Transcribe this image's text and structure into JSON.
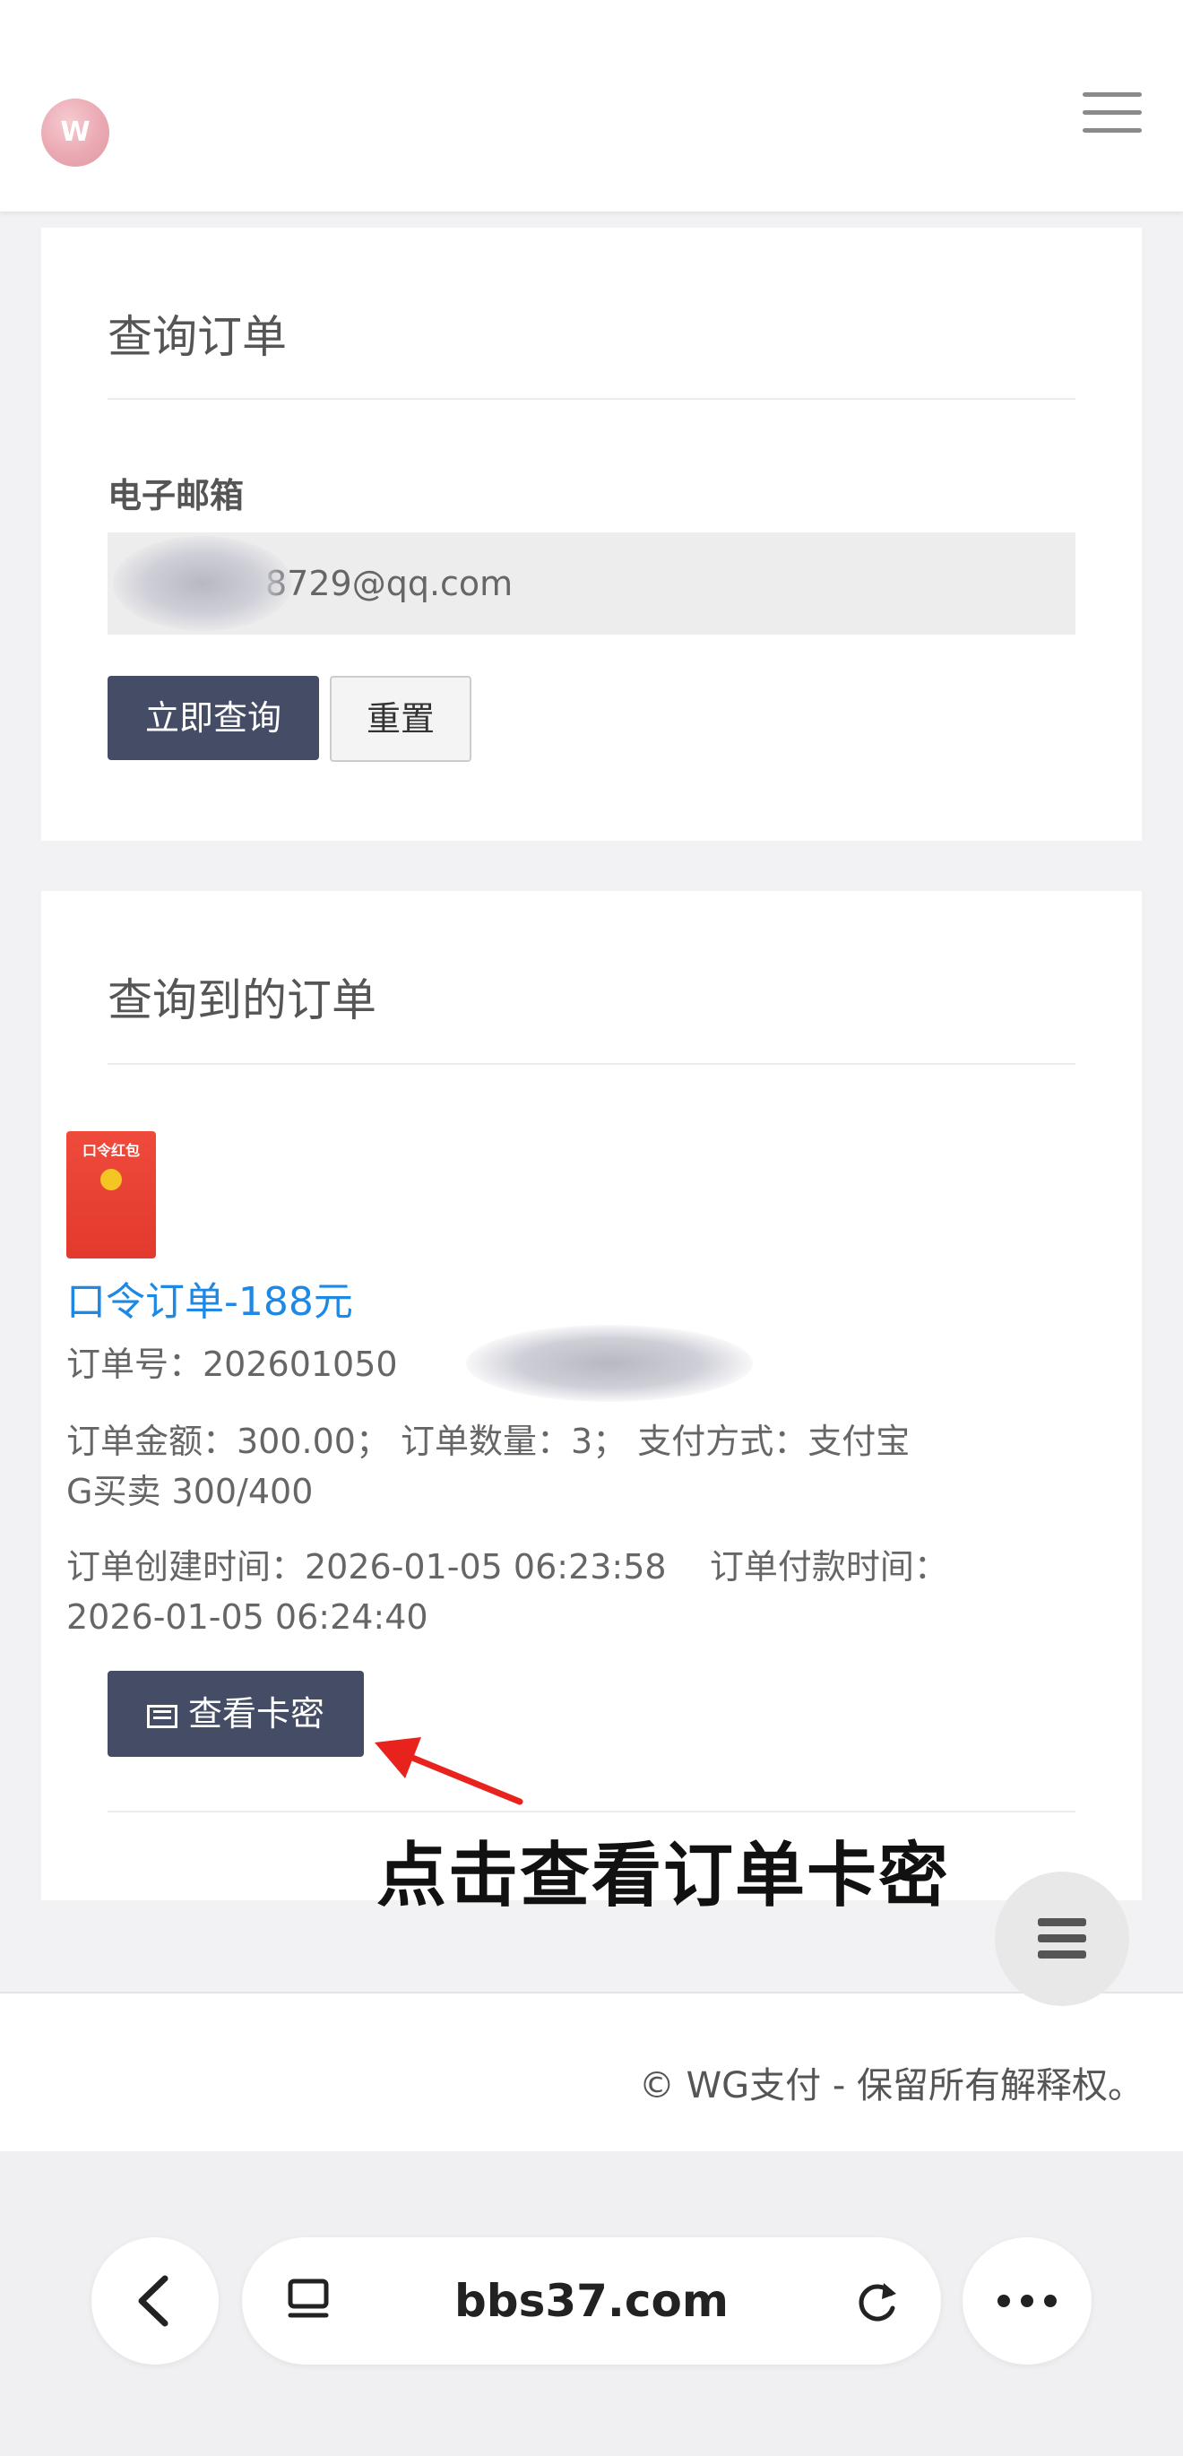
{
  "header": {
    "logo_text": "W"
  },
  "query_card": {
    "title": "查询订单",
    "email_label": "电子邮箱",
    "email_value": "8729@qq.com",
    "query_button": "立即查询",
    "reset_button": "重置"
  },
  "result_card": {
    "title": "查询到的订单",
    "product_image_text": "口令红包",
    "order_name": "口令订单-188元",
    "order_no": "订单号：202601050",
    "order_amount_line": "订单金额：300.00； 订单数量：3； 支付方式：支付宝",
    "order_sub_line": "G买卖 300/400",
    "create_time_line": "订单创建时间：2026-01-05 06:23:58    订单付款时间：",
    "pay_time_line": "2026-01-05 06:24:40",
    "view_button": "查看卡密"
  },
  "annotation": {
    "text": "点击查看订单卡密",
    "arrow_color": "#e8231d"
  },
  "footer": {
    "copyright": "© WG支付 - 保留所有解释权。"
  },
  "browser": {
    "url": "bbs37.com"
  },
  "colors": {
    "primary_button": "#454d66",
    "link_blue": "#1e88e5"
  }
}
